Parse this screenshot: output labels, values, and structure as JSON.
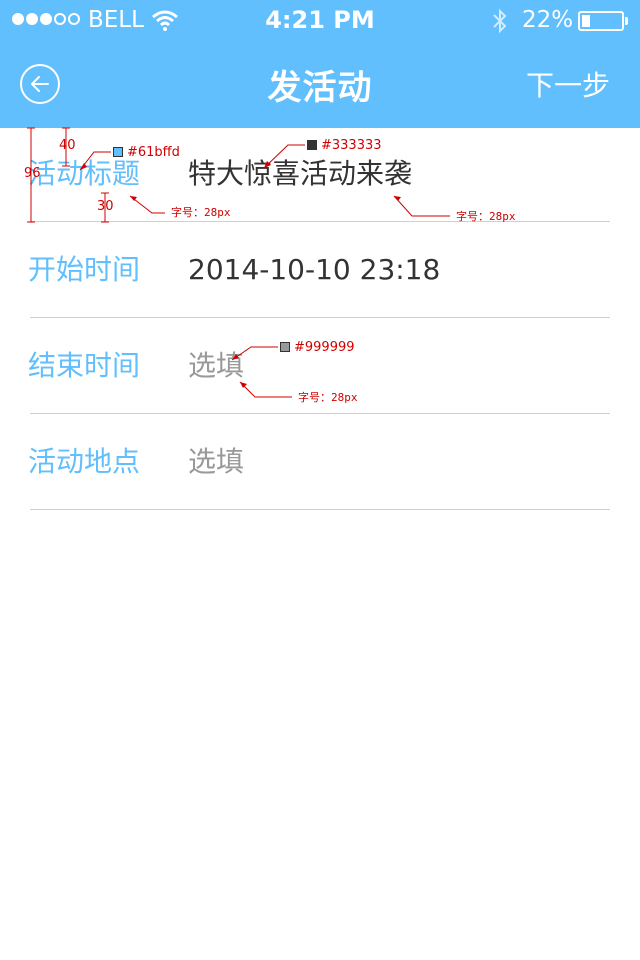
{
  "status_bar": {
    "carrier": "BELL",
    "time": "4:21 PM",
    "battery": "22%",
    "battery_level": 0.22
  },
  "nav": {
    "title": "发活动",
    "next_label": "下一步",
    "back_icon": "back-circle-arrow-icon"
  },
  "form": {
    "rows": [
      {
        "label": "活动标题",
        "value": "特大惊喜活动来袭",
        "state": "filled"
      },
      {
        "label": "开始时间",
        "value": "2014-10-10 23:18",
        "state": "filled"
      },
      {
        "label": "结束时间",
        "value": "选填",
        "state": "placeholder"
      },
      {
        "label": "活动地点",
        "value": "选填",
        "state": "placeholder"
      }
    ]
  },
  "annotations": {
    "row_height": "96",
    "top_spacing": "40",
    "text_height": "30",
    "label_color": "#61bffd",
    "value_color": "#333333",
    "placeholder_color": "#999999",
    "label_font": "字号：28px",
    "value_font": "字号：28px",
    "placeholder_font": "字号：28px"
  },
  "colors": {
    "accent": "#61bffd",
    "text": "#333333",
    "placeholder": "#999999"
  }
}
